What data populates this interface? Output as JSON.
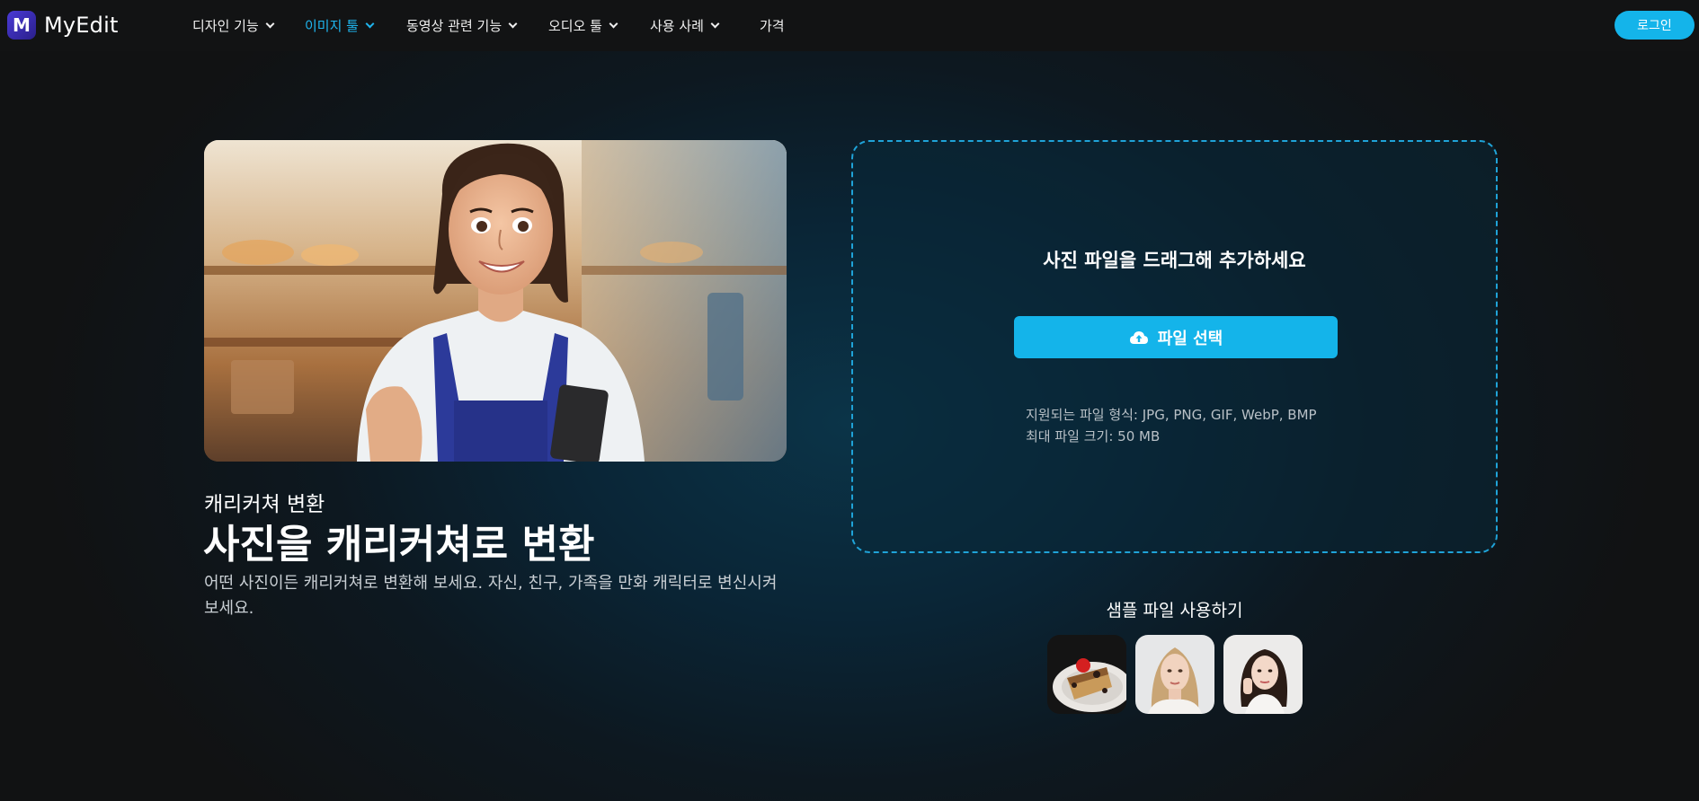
{
  "brand": {
    "name": "MyEdit",
    "logo_letter": "M"
  },
  "nav": {
    "items": [
      {
        "label": "디자인 기능",
        "has_dropdown": true,
        "active": false
      },
      {
        "label": "이미지 툴",
        "has_dropdown": true,
        "active": true
      },
      {
        "label": "동영상 관련 기능",
        "has_dropdown": true,
        "active": false
      },
      {
        "label": "오디오 툴",
        "has_dropdown": true,
        "active": false
      },
      {
        "label": "사용 사례",
        "has_dropdown": true,
        "active": false
      },
      {
        "label": "가격",
        "has_dropdown": false,
        "active": false
      }
    ],
    "login_label": "로그인"
  },
  "hero": {
    "subtitle": "캐리커쳐 변환",
    "title": "사진을 캐리커쳐로 변환",
    "description": "어떤 사진이든 캐리커쳐로 변환해 보세요. 자신, 친구, 가족을 만화 캐릭터로 변신시켜 보세요."
  },
  "upload": {
    "heading": "사진 파일을 드래그해 추가하세요",
    "button_label": "파일 선택",
    "button_icon": "cloud-upload-icon",
    "formats_line": "지원되는 파일 형식: JPG, PNG, GIF, WebP, BMP",
    "max_size_line": "최대 파일 크기: 50 MB"
  },
  "samples": {
    "label": "샘플 파일 사용하기",
    "items": [
      {
        "name": "sample-cake"
      },
      {
        "name": "sample-woman-blonde"
      },
      {
        "name": "sample-woman-dark-hair"
      }
    ]
  },
  "colors": {
    "accent": "#14b4ea",
    "active_nav": "#1fb5ee",
    "background": "#111213"
  }
}
